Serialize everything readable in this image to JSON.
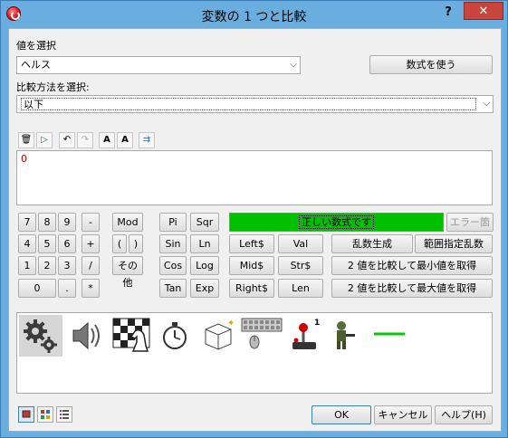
{
  "window": {
    "title": "変数の 1 つと比較",
    "help_glyph": "?",
    "close_glyph": "✕"
  },
  "value_select": {
    "label": "値を選択",
    "selected": "ヘルス",
    "use_expression_button": "数式を使う"
  },
  "compare_method": {
    "label": "比較方法を選択:",
    "selected": "以下"
  },
  "expression": {
    "value": "0",
    "status_text": "正しい数式です",
    "status_color": "#00c000",
    "error_button": "エラー箇所"
  },
  "keypad": {
    "keys": [
      "7",
      "8",
      "9",
      "4",
      "5",
      "6",
      "1",
      "2",
      "3",
      "0",
      "."
    ],
    "operators": [
      "-",
      "+",
      "/",
      "*"
    ],
    "mod": "Mod",
    "open_paren": "(",
    "close_paren": ")",
    "other": "その他"
  },
  "functions": {
    "pi": "Pi",
    "sqr": "Sqr",
    "sin": "Sin",
    "ln": "Ln",
    "cos": "Cos",
    "log": "Log",
    "tan": "Tan",
    "exp": "Exp",
    "left": "Left$",
    "val": "Val",
    "mid": "Mid$",
    "str": "Str$",
    "right": "Right$",
    "len": "Len",
    "random": "乱数生成",
    "random_range": "範囲指定乱数",
    "min_of_two": "2 値を比較して最小値を取得",
    "max_of_two": "2 値を比較して最大値を取得"
  },
  "object_icons": [
    "gears-icon",
    "speaker-icon",
    "chess-knight-icon",
    "stopwatch-icon",
    "box-icon",
    "keyboard-mouse-icon",
    "joystick-icon",
    "soldier-sprite-icon",
    "green-line-icon"
  ],
  "footer": {
    "ok": "OK",
    "cancel": "キャンセル",
    "help": "ヘルプ(H)"
  }
}
